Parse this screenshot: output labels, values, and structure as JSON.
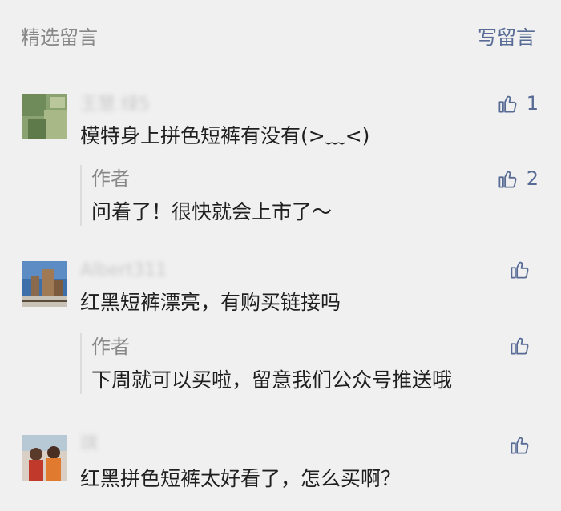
{
  "header": {
    "title": "精选留言",
    "write_label": "写留言"
  },
  "comments": [
    {
      "nickname": "王慧 绿5",
      "text": "模特身上拼色短裤有没有(>﹏<)",
      "likes": "1",
      "reply": {
        "author": "作者",
        "text": "问着了！很快就会上市了～",
        "likes": "2"
      }
    },
    {
      "nickname": "Albert311",
      "text": "红黑短裤漂亮，有购买链接吗",
      "likes": "",
      "reply": {
        "author": "作者",
        "text": "下周就可以买啦，留意我们公众号推送哦",
        "likes": ""
      }
    },
    {
      "nickname": "琪",
      "text": "红黑拼色短裤太好看了，怎么买啊？",
      "likes": ""
    }
  ],
  "icons": {
    "like": "thumbs-up-icon"
  },
  "colors": {
    "link": "#576b95",
    "muted": "#888888",
    "background": "#f0f0f0"
  }
}
